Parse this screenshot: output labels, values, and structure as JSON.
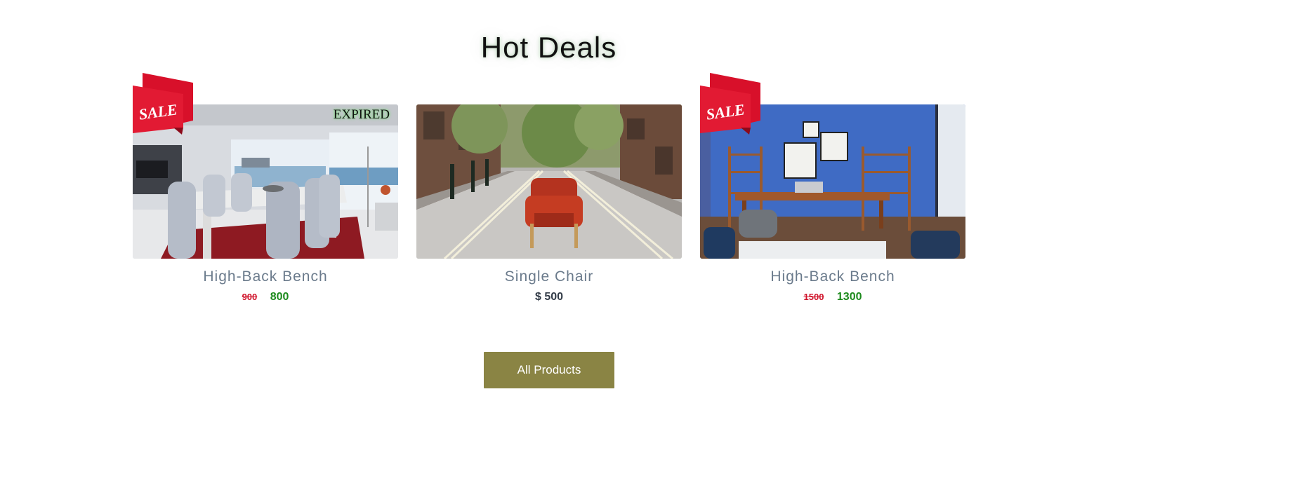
{
  "section": {
    "title": "Hot Deals"
  },
  "products": [
    {
      "name": "High-Back Bench",
      "old_price": "900",
      "new_price": "800",
      "badge": "SALE",
      "status": "EXPIRED"
    },
    {
      "name": "Single Chair",
      "price": "$ 500"
    },
    {
      "name": "High-Back Bench",
      "old_price": "1500",
      "new_price": "1300",
      "badge": "SALE"
    }
  ],
  "button": {
    "label": "All Products"
  },
  "colors": {
    "old_price": "#d0142b",
    "new_price": "#1d8a1d",
    "button_bg": "#8a8444",
    "sale_badge": "#d8102a",
    "name_text": "#6b7b8c"
  },
  "icons": [
    "sale-ribbon-icon"
  ]
}
